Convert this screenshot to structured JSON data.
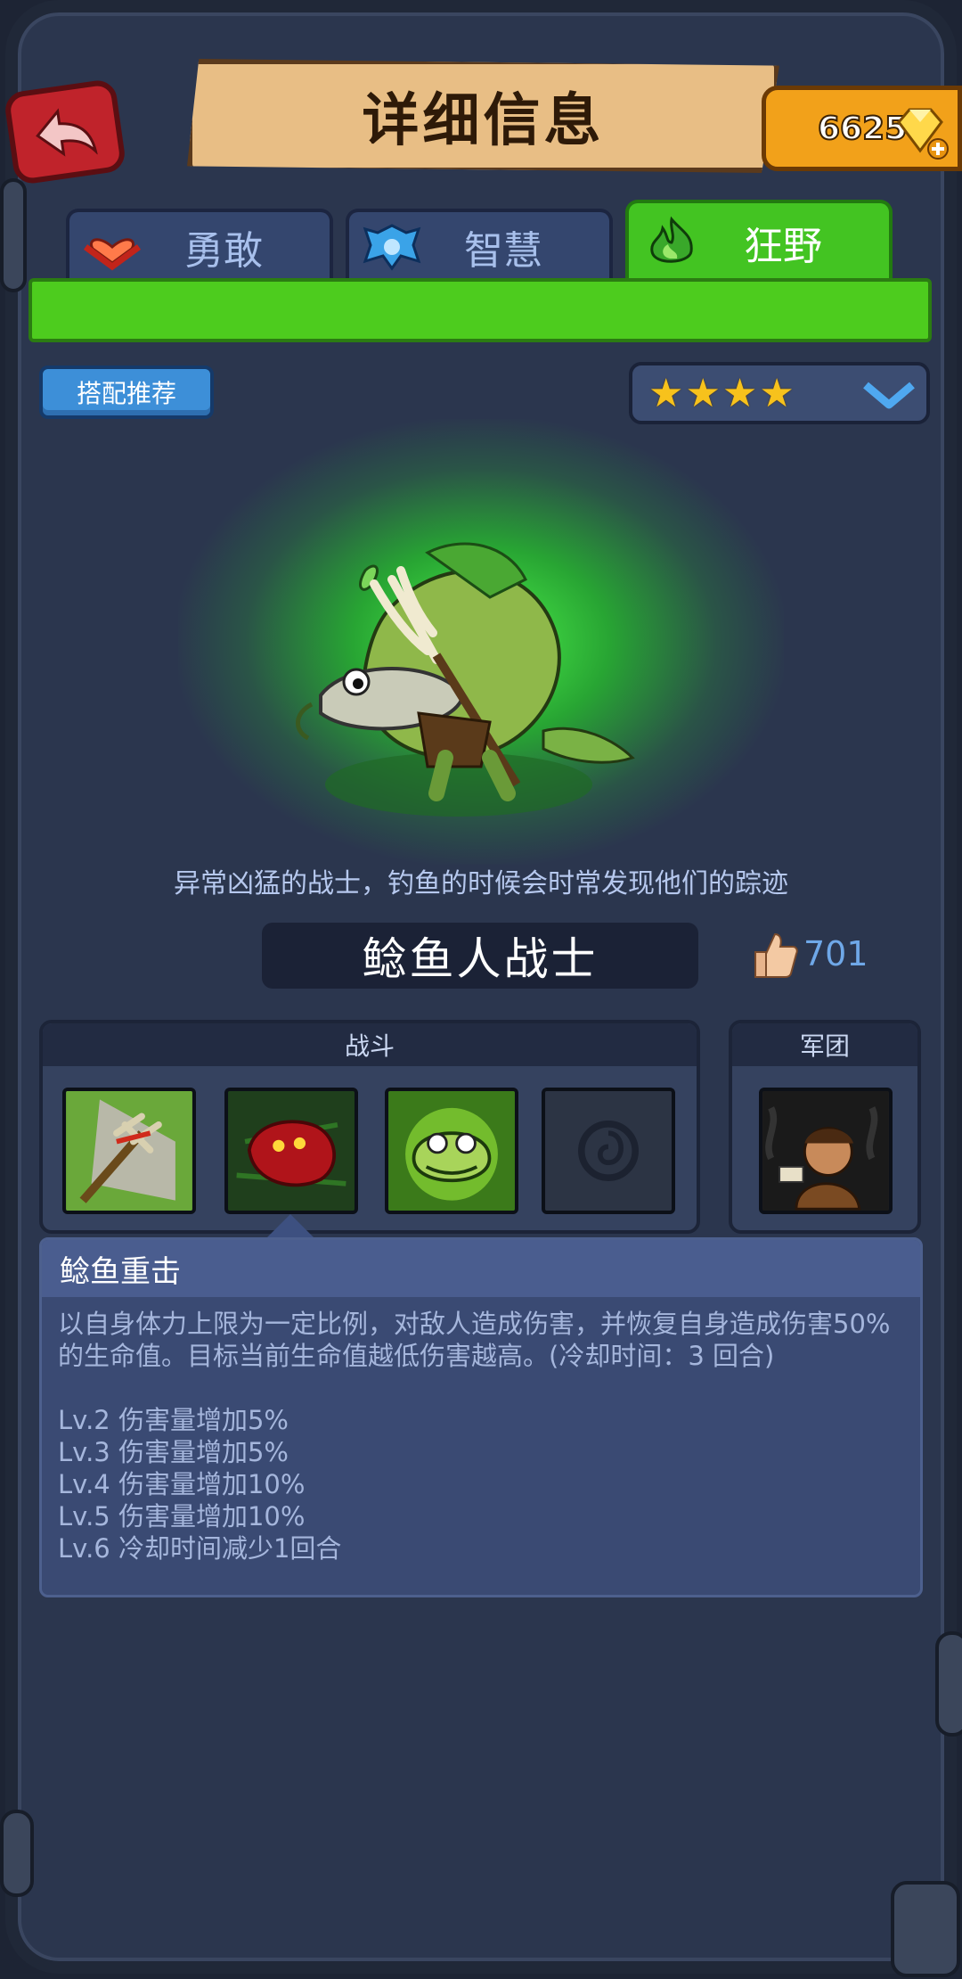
{
  "header": {
    "title": "详细信息",
    "gems": "6625",
    "back_icon": "back-arrow-icon",
    "gem_icon": "diamond-plus-icon"
  },
  "tabs": [
    {
      "label": "勇敢",
      "icon": "heart-chevron-icon",
      "active": false
    },
    {
      "label": "智慧",
      "icon": "blue-crest-icon",
      "active": false
    },
    {
      "label": "狂野",
      "icon": "green-flame-icon",
      "active": true
    }
  ],
  "toolbar": {
    "recommend_label": "搭配推荐",
    "stars": 4
  },
  "hero": {
    "description": "异常凶猛的战士，钓鱼的时候会时常发现他们的踪迹",
    "name": "鲶鱼人战士",
    "likes": "701"
  },
  "skills": {
    "battle_label": "战斗",
    "legion_label": "军团",
    "battle_skills": [
      "trident-strike-icon",
      "red-blob-icon",
      "catfish-poison-icon",
      "locked-skill-icon"
    ],
    "legion_skills": [
      "caveman-icon"
    ]
  },
  "detail": {
    "title": "鲶鱼重击",
    "description": "以自身体力上限为一定比例，对敌人造成伤害，并恢复自身造成伤害50%的生命值。目标当前生命值越低伤害越高。(冷却时间：3 回合)",
    "levels": [
      "Lv.2 伤害量增加5%",
      "Lv.3 伤害量增加5%",
      "Lv.4 伤害量增加10%",
      "Lv.5 伤害量增加10%",
      "Lv.6 冷却时间减少1回合"
    ]
  },
  "colors": {
    "accent_green": "#4dcc1e",
    "panel": "#2b364e",
    "banner": "#e8be85"
  }
}
